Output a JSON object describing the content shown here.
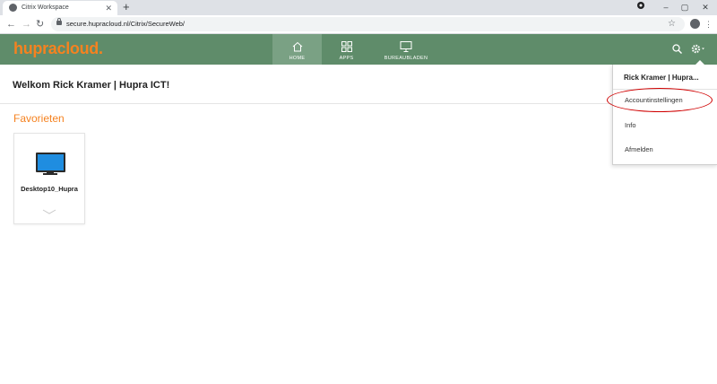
{
  "browser": {
    "tab_title": "Citrix Workspace",
    "tab_close": "✕",
    "new_tab": "+",
    "url": "secure.hupracloud.nl/Citrix/SecureWeb/",
    "window_controls": {
      "minimize": "–",
      "maximize": "▢",
      "close": "✕"
    }
  },
  "app": {
    "logo_text": "hupracloud.",
    "nav": [
      {
        "label": "HOME",
        "icon": "home-icon",
        "active": true
      },
      {
        "label": "APPS",
        "icon": "apps-grid-icon",
        "active": false
      },
      {
        "label": "BUREAUBLADEN",
        "icon": "monitor-icon",
        "active": false
      }
    ],
    "welcome": "Welkom Rick Kramer | Hupra ICT!",
    "favorites_title": "Favorieten",
    "favorites": [
      {
        "label": "Desktop10_Hupra",
        "icon": "desktop-monitor-icon"
      }
    ]
  },
  "account_menu": {
    "user": "Rick Kramer | Hupra...",
    "items": [
      "Accountinstellingen",
      "Info",
      "Afmelden"
    ]
  },
  "colors": {
    "header_green": "#5f8c6a",
    "active_tab_green": "#7aa184",
    "brand_orange": "#f58220",
    "highlight_red": "#d00000"
  }
}
